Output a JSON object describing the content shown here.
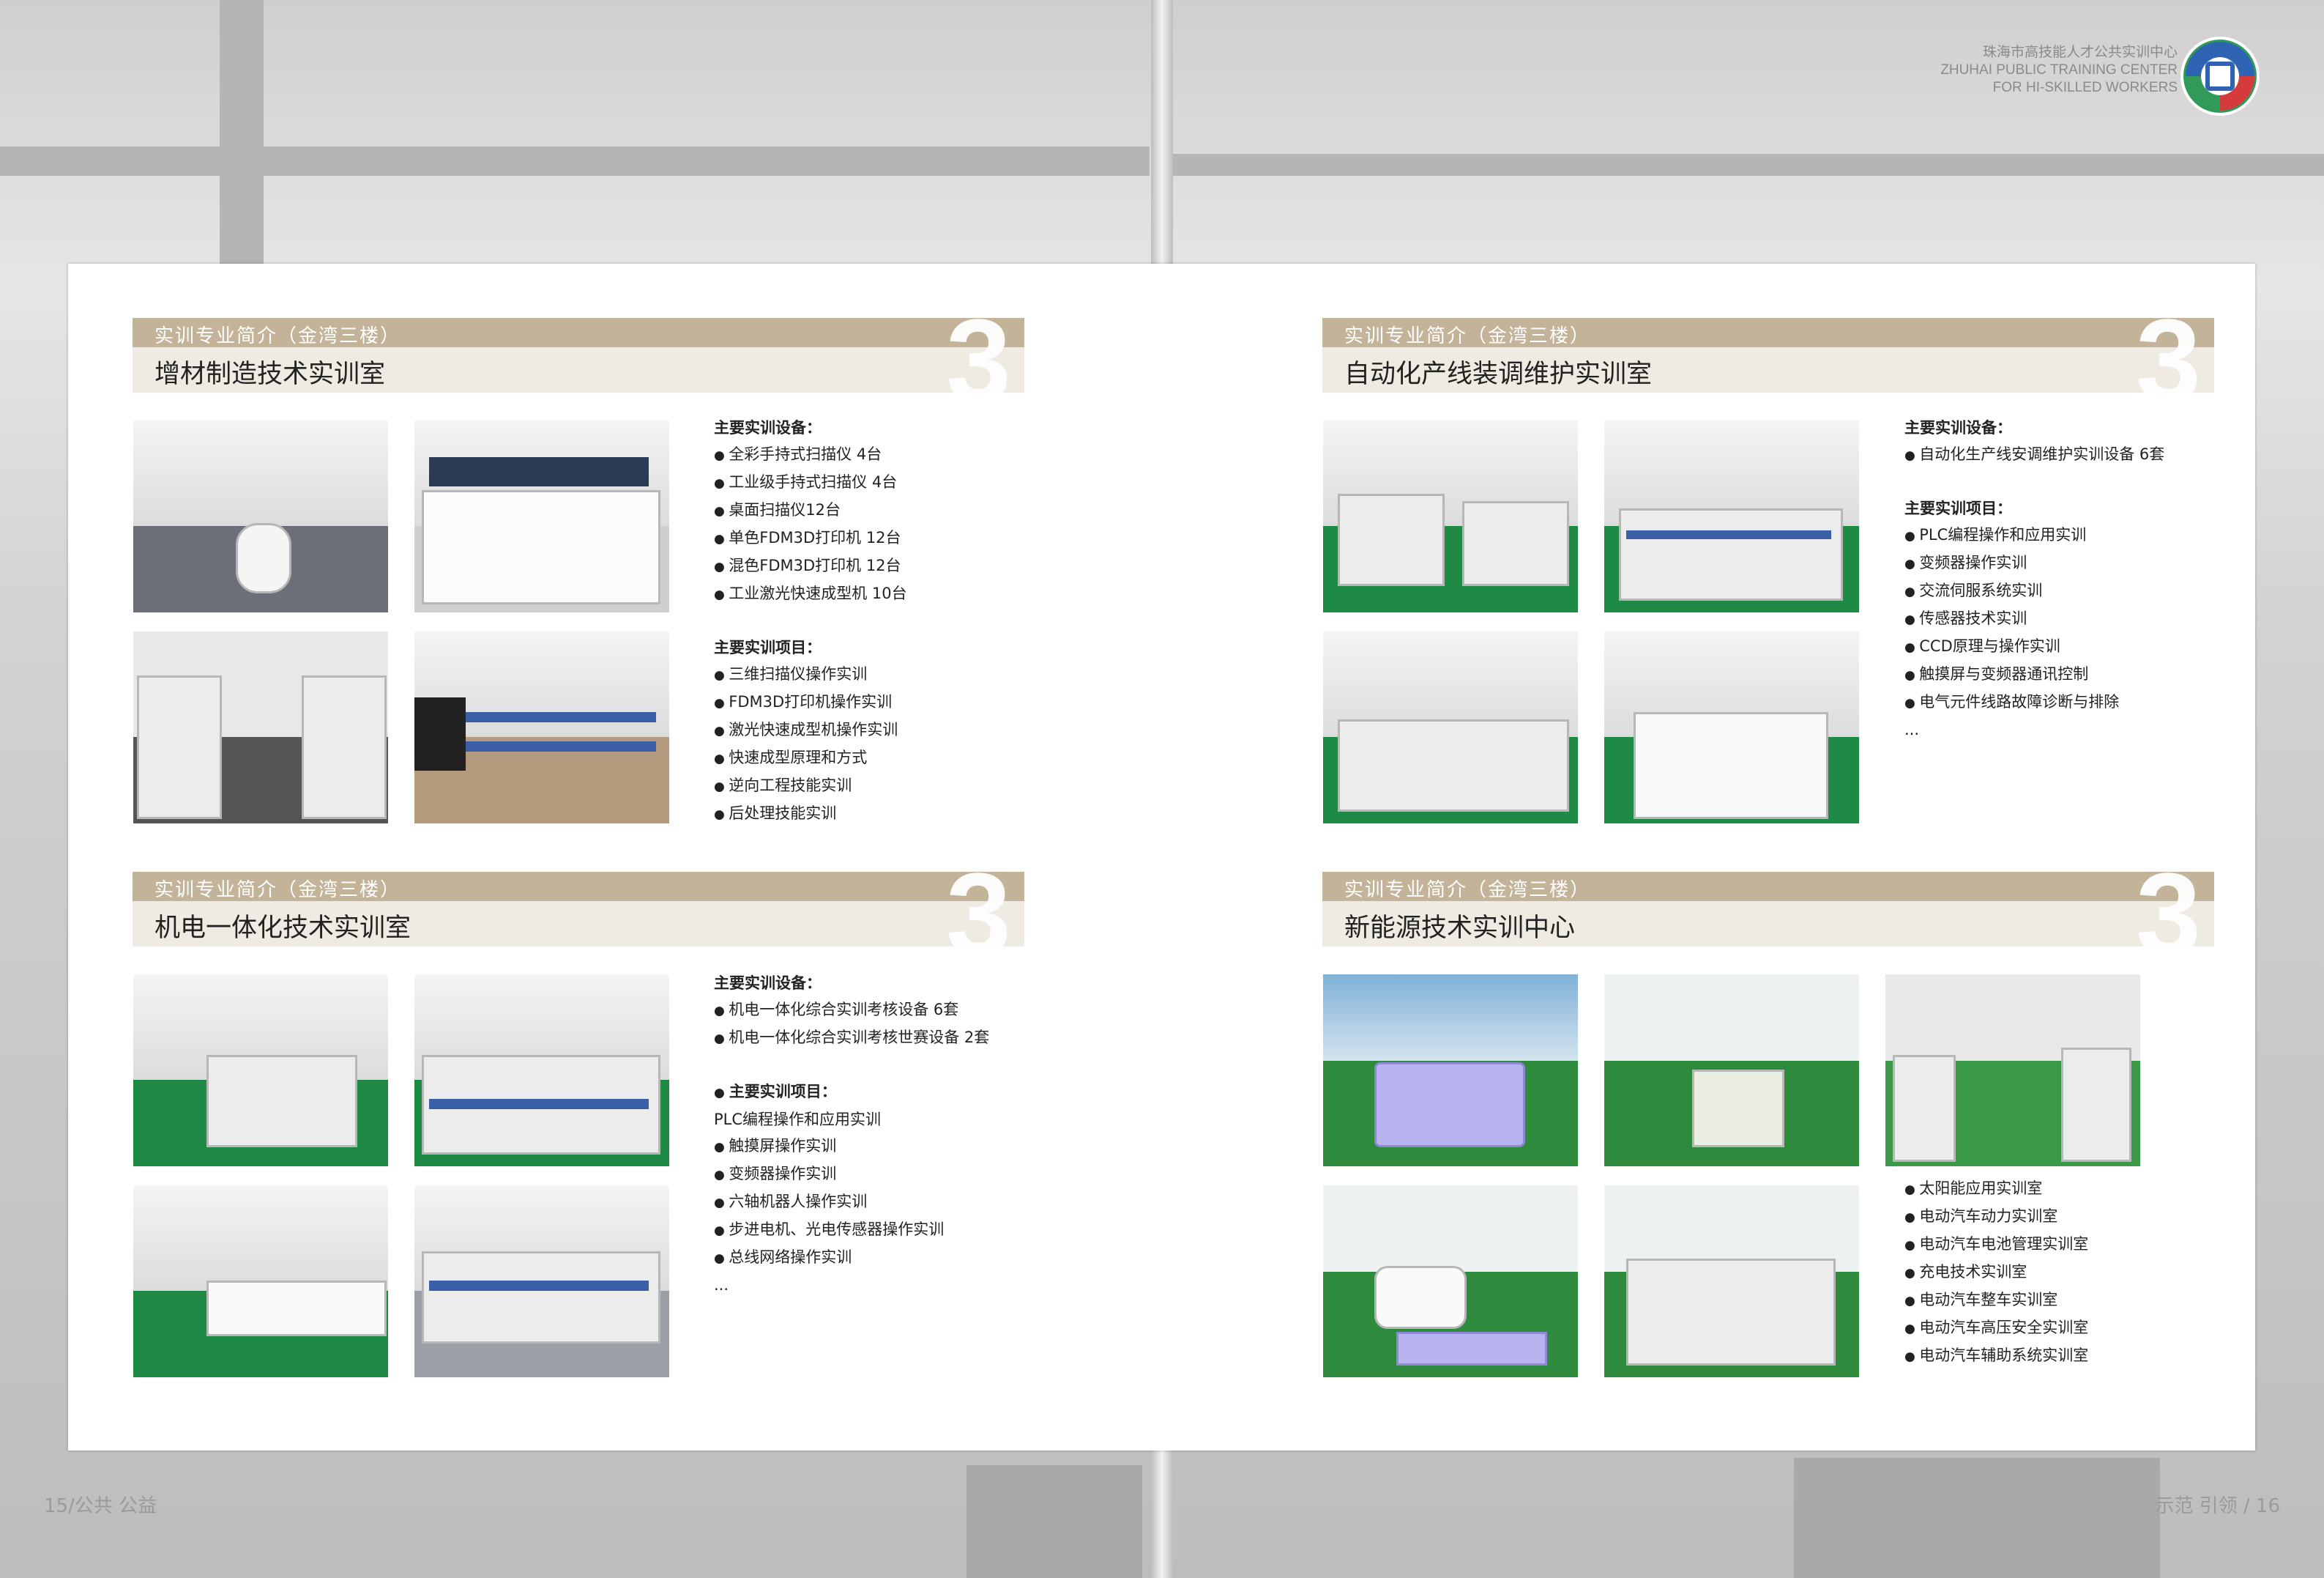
{
  "header": {
    "org_cn": "珠海市高技能人才公共实训中心",
    "org_en_1": "ZHUHAI PUBLIC TRAINING CENTER",
    "org_en_2": "FOR HI-SKILLED WORKERS"
  },
  "sections": [
    {
      "subtitle": "实训专业简介（金湾三楼）",
      "title": "增材制造技术实训室",
      "number": "3",
      "lines": [
        {
          "text": "主要实训设备：",
          "type": "head"
        },
        {
          "text": "全彩手持式扫描仪 4台",
          "type": "bullet"
        },
        {
          "text": "工业级手持式扫描仪 4台",
          "type": "bullet"
        },
        {
          "text": "桌面扫描仪12台",
          "type": "bullet"
        },
        {
          "text": "单色FDM3D打印机 12台",
          "type": "bullet"
        },
        {
          "text": "混色FDM3D打印机 12台",
          "type": "bullet"
        },
        {
          "text": "工业激光快速成型机 10台",
          "type": "bullet"
        },
        {
          "text": "",
          "type": "gap"
        },
        {
          "text": "主要实训项目：",
          "type": "head"
        },
        {
          "text": "三维扫描仪操作实训",
          "type": "bullet"
        },
        {
          "text": "FDM3D打印机操作实训",
          "type": "bullet"
        },
        {
          "text": "激光快速成型机操作实训",
          "type": "bullet"
        },
        {
          "text": "快速成型原理和方式",
          "type": "bullet"
        },
        {
          "text": "逆向工程技能实训",
          "type": "bullet"
        },
        {
          "text": "后处理技能实训",
          "type": "bullet"
        }
      ]
    },
    {
      "subtitle": "实训专业简介（金湾三楼）",
      "title": "自动化产线装调维护实训室",
      "number": "3",
      "lines": [
        {
          "text": "主要实训设备：",
          "type": "head"
        },
        {
          "text": "自动化生产线安调维护实训设备 6套",
          "type": "bullet"
        },
        {
          "text": "",
          "type": "gap"
        },
        {
          "text": "主要实训项目：",
          "type": "head"
        },
        {
          "text": "PLC编程操作和应用实训",
          "type": "bullet"
        },
        {
          "text": "变频器操作实训",
          "type": "bullet"
        },
        {
          "text": "交流伺服系统实训",
          "type": "bullet"
        },
        {
          "text": "传感器技术实训",
          "type": "bullet"
        },
        {
          "text": "CCD原理与操作实训",
          "type": "bullet"
        },
        {
          "text": "触摸屏与变频器通讯控制",
          "type": "bullet"
        },
        {
          "text": "电气元件线路故障诊断与排除",
          "type": "bullet"
        },
        {
          "text": "...",
          "type": "plain"
        }
      ]
    },
    {
      "subtitle": "实训专业简介（金湾三楼）",
      "title": "机电一体化技术实训室",
      "number": "3",
      "lines": [
        {
          "text": "主要实训设备：",
          "type": "head"
        },
        {
          "text": "机电一体化综合实训考核设备 6套",
          "type": "bullet"
        },
        {
          "text": "机电一体化综合实训考核世赛设备 2套",
          "type": "bullet"
        },
        {
          "text": "",
          "type": "gap"
        },
        {
          "text": "主要实训项目：",
          "type": "headbullet"
        },
        {
          "text": "PLC编程操作和应用实训",
          "type": "plain"
        },
        {
          "text": "触摸屏操作实训",
          "type": "bullet"
        },
        {
          "text": "变频器操作实训",
          "type": "bullet"
        },
        {
          "text": "六轴机器人操作实训",
          "type": "bullet"
        },
        {
          "text": "步进电机、光电传感器操作实训",
          "type": "bullet"
        },
        {
          "text": "总线网络操作实训",
          "type": "bullet"
        },
        {
          "text": "...",
          "type": "plain"
        }
      ]
    },
    {
      "subtitle": "实训专业简介（金湾三楼）",
      "title": "新能源技术实训中心",
      "number": "3",
      "lines": [
        {
          "text": "太阳能应用实训室",
          "type": "bullet"
        },
        {
          "text": "电动汽车动力实训室",
          "type": "bullet"
        },
        {
          "text": "电动汽车电池管理实训室",
          "type": "bullet"
        },
        {
          "text": "充电技术实训室",
          "type": "bullet"
        },
        {
          "text": "电动汽车整车实训室",
          "type": "bullet"
        },
        {
          "text": "电动汽车高压安全实训室",
          "type": "bullet"
        },
        {
          "text": "电动汽车辅助系统实训室",
          "type": "bullet"
        }
      ]
    }
  ],
  "footer": {
    "left": "15/公共 公益",
    "right": "示范 引领 / 16"
  },
  "colors": {
    "banner_top": "#c2b399",
    "banner_bottom": "#efebe3",
    "floor_green": "#1f8a45"
  }
}
